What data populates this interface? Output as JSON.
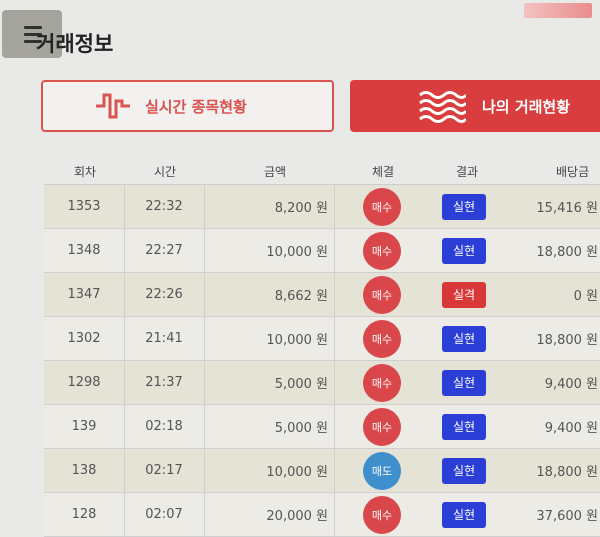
{
  "header": {
    "title": "거래정보",
    "menu_icon": "hamburger-icon"
  },
  "tabs": [
    {
      "label": "실시간 종목현황",
      "icon": "pulse-wave-icon",
      "active": false
    },
    {
      "label": "나의 거래현황",
      "icon": "waves-icon",
      "active": true
    }
  ],
  "table": {
    "columns": [
      "회차",
      "시간",
      "금액",
      "체결",
      "결과",
      "배당금"
    ],
    "rows": [
      {
        "round": "1353",
        "time": "22:32",
        "amount": "8,200 원",
        "execution": "매수",
        "result": "실현",
        "payout": "15,416 원"
      },
      {
        "round": "1348",
        "time": "22:27",
        "amount": "10,000 원",
        "execution": "매수",
        "result": "실현",
        "payout": "18,800 원"
      },
      {
        "round": "1347",
        "time": "22:26",
        "amount": "8,662 원",
        "execution": "매수",
        "result": "실격",
        "payout": "0 원"
      },
      {
        "round": "1302",
        "time": "21:41",
        "amount": "10,000 원",
        "execution": "매수",
        "result": "실현",
        "payout": "18,800 원"
      },
      {
        "round": "1298",
        "time": "21:37",
        "amount": "5,000 원",
        "execution": "매수",
        "result": "실현",
        "payout": "9,400 원"
      },
      {
        "round": "139",
        "time": "02:18",
        "amount": "5,000 원",
        "execution": "매수",
        "result": "실현",
        "payout": "9,400 원"
      },
      {
        "round": "138",
        "time": "02:17",
        "amount": "10,000 원",
        "execution": "매도",
        "result": "실현",
        "payout": "18,800 원"
      },
      {
        "round": "128",
        "time": "02:07",
        "amount": "20,000 원",
        "execution": "매수",
        "result": "실현",
        "payout": "37,600 원"
      }
    ]
  },
  "colors": {
    "accent_red": "#d93d3d",
    "buy": "#d9474a",
    "sell": "#3f8fcc",
    "realized": "#2b3fd6",
    "disqualified": "#d93838"
  }
}
